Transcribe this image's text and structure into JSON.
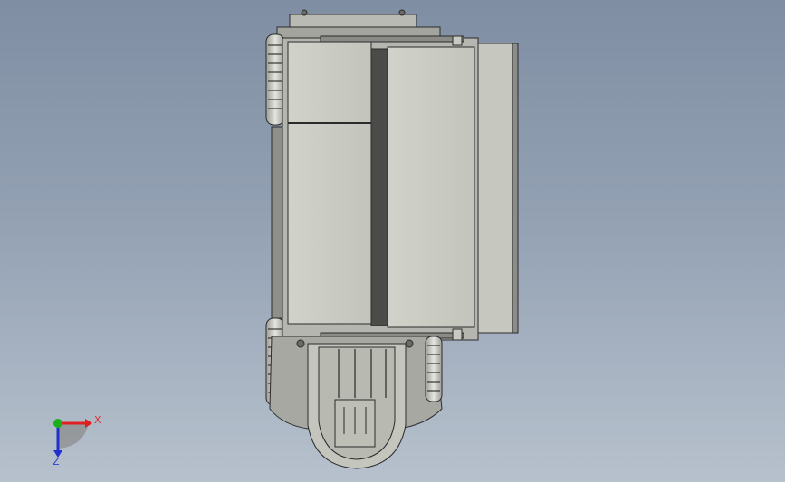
{
  "viewport": {
    "model": "top-view-assembly",
    "colors": {
      "background_top": "#7f8ea3",
      "background_bottom": "#b7c1cd",
      "part_light": "#c9cac2",
      "part_mid": "#a9aaa3",
      "part_dark": "#4b4c49",
      "edge": "#2b2b2b"
    }
  },
  "triad": {
    "x_label": "X",
    "z_label": "Z",
    "x_color": "#e02020",
    "y_color": "#19b019",
    "z_color": "#2030d0"
  }
}
